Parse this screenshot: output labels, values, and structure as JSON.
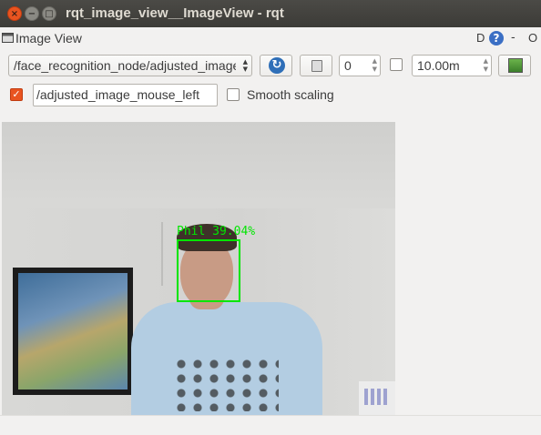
{
  "window": {
    "title": "rqt_image_view__ImageView - rqt",
    "close_glyph": "×",
    "min_glyph": "−",
    "max_glyph": "□"
  },
  "dock": {
    "title": "Image View",
    "d_label": "D",
    "help_glyph": "?",
    "dash_label": "-",
    "o_label": "O"
  },
  "toolbar": {
    "topic_value": "/face_recognition_node/adjusted_image",
    "refresh_icon": "refresh-icon",
    "save_icon": "save-icon",
    "rotation_value": "0",
    "fps_checked": false,
    "fps_value": "10.00m",
    "zoom_icon": "zoom-fit-icon"
  },
  "row2": {
    "mouse_checked": true,
    "mouse_check_glyph": "✓",
    "mouse_topic_value": "/adjusted_image_mouse_left",
    "smooth_label": "Smooth scaling",
    "smooth_checked": false
  },
  "image": {
    "detection_label": "Phil 39.04%",
    "box_color": "#00e600"
  },
  "colors": {
    "accent": "#e95420",
    "titlebar": "#3c3b37",
    "refresh_blue": "#2f6fb8"
  }
}
